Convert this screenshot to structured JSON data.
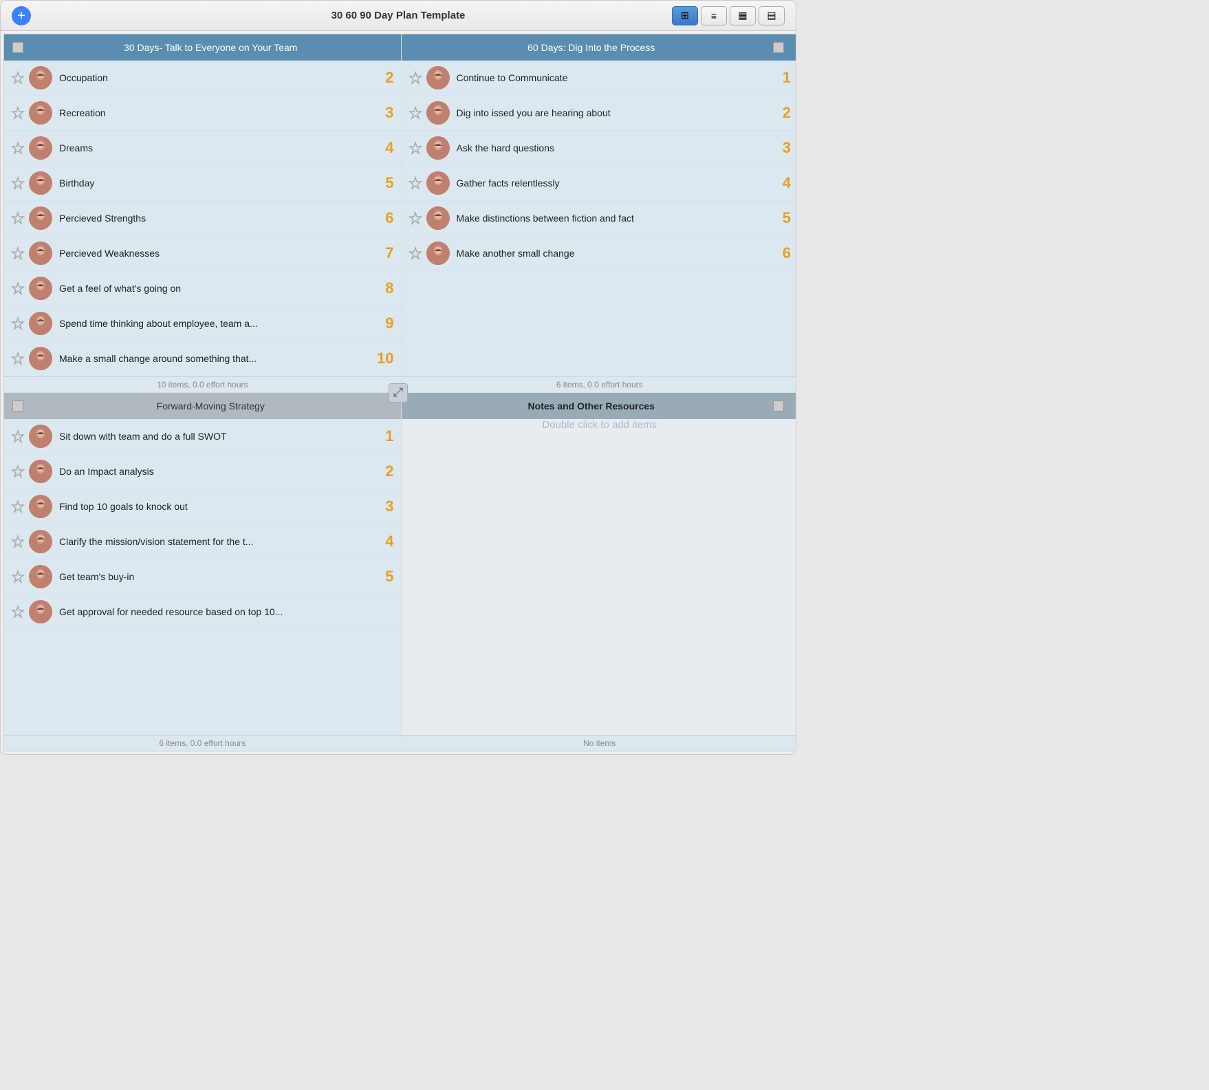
{
  "window": {
    "title": "30 60 90 Day Plan Template"
  },
  "toolbar": {
    "add_label": "+",
    "view_grid": "⊞",
    "view_list": "≡",
    "view_cal": "📅",
    "view_gantt": "📊"
  },
  "quadrants": [
    {
      "id": "q1",
      "header": "30 Days- Talk to Everyone on Your Team",
      "header_type": "blue",
      "footer": "10 items, 0.0 effort hours",
      "items": [
        {
          "text": "Occupation",
          "number": "2"
        },
        {
          "text": "Recreation",
          "number": "3"
        },
        {
          "text": "Dreams",
          "number": "4"
        },
        {
          "text": "Birthday",
          "number": "5"
        },
        {
          "text": "Percieved Strengths",
          "number": "6"
        },
        {
          "text": "Percieved Weaknesses",
          "number": "7"
        },
        {
          "text": "Get a feel of what's going on",
          "number": "8"
        },
        {
          "text": "Spend time thinking about employee, team a...",
          "number": "9"
        },
        {
          "text": "Make a small change around something that...",
          "number": "10"
        }
      ]
    },
    {
      "id": "q2",
      "header": "60 Days: Dig Into the Process",
      "header_type": "blue",
      "footer": "6 items, 0.0 effort hours",
      "items": [
        {
          "text": "Continue to Communicate",
          "number": "1"
        },
        {
          "text": "Dig into issed you are hearing about",
          "number": "2"
        },
        {
          "text": "Ask the hard questions",
          "number": "3"
        },
        {
          "text": "Gather facts relentlessly",
          "number": "4"
        },
        {
          "text": "Make distinctions between fiction and fact",
          "number": "5"
        },
        {
          "text": "Make another small change",
          "number": "6"
        }
      ]
    },
    {
      "id": "q3",
      "header": "Forward-Moving Strategy",
      "header_type": "gray",
      "footer": "6 items, 0.0 effort hours",
      "items": [
        {
          "text": "Sit down with team and do a full SWOT",
          "number": "1"
        },
        {
          "text": "Do an Impact analysis",
          "number": "2"
        },
        {
          "text": "Find top 10 goals to knock out",
          "number": "3"
        },
        {
          "text": "Clarify the mission/vision statement for the t...",
          "number": "4"
        },
        {
          "text": "Get team's buy-in",
          "number": "5"
        },
        {
          "text": "Get approval for needed resource based on top 10...",
          "number": ""
        }
      ]
    },
    {
      "id": "q4",
      "header": "Notes and Other Resources",
      "header_type": "dark-gray",
      "footer": "No items",
      "empty_hint": "Double click to add items",
      "items": []
    }
  ]
}
